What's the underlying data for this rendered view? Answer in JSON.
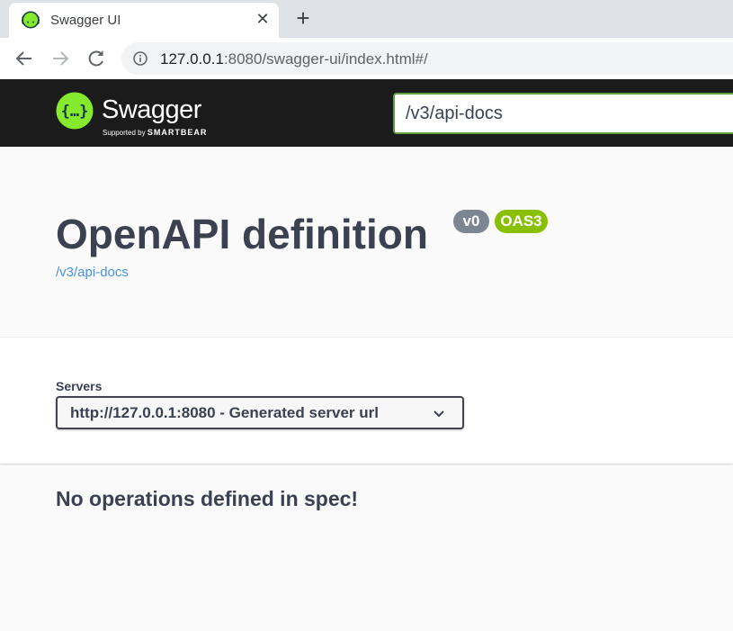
{
  "browser": {
    "tab_title": "Swagger UI",
    "close_glyph": "✕",
    "newtab_glyph": "+",
    "url_host": "127.0.0.1",
    "url_rest": ":8080/swagger-ui/index.html#/"
  },
  "topbar": {
    "logo_text": "Swagger",
    "logo_sub_prefix": "Supported by",
    "logo_sub_brand": "SMARTBEAR",
    "api_url_value": "/v3/api-docs",
    "accent_color": "#62a03f"
  },
  "info": {
    "title": "OpenAPI definition",
    "version_badge": "v0",
    "oas_badge": "OAS3",
    "spec_link": "/v3/api-docs"
  },
  "servers": {
    "label": "Servers",
    "selected": "http://127.0.0.1:8080 - Generated server url"
  },
  "operations": {
    "empty_message": "No operations defined in spec!"
  },
  "colors": {
    "topbar_bg": "#1b1b1b",
    "badge_version": "#7d8492",
    "badge_oas": "#89bf04",
    "link": "#4990e2",
    "text": "#3b4151"
  }
}
